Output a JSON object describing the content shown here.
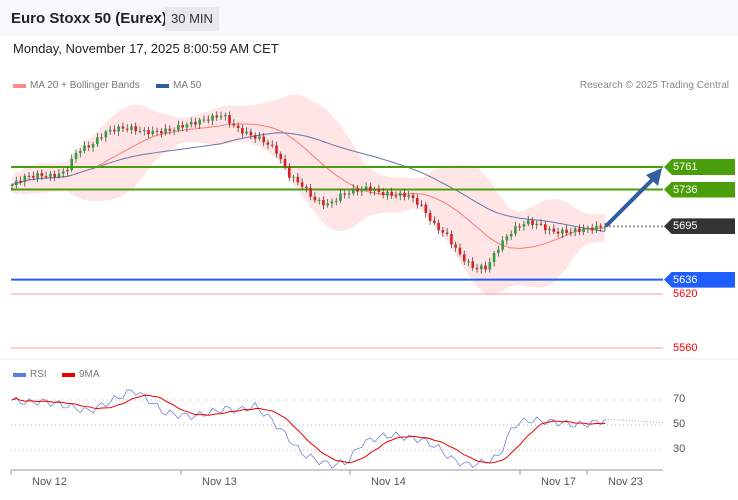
{
  "header": {
    "title": "Euro Stoxx 50 (Eurex)",
    "timeframe": "30 MIN",
    "datetime": "Monday, November 17, 2025 8:00:59 AM CET"
  },
  "legend": {
    "ma20": "MA 20 + Bollinger Bands",
    "ma50": "MA 50",
    "credit": "Research © 2025 Trading Central"
  },
  "rsi_legend": {
    "rsi": "RSI",
    "ma9": "9MA"
  },
  "colors": {
    "up": "#2e9e3a",
    "down": "#d92020",
    "green": "#4a9e0a",
    "blue": "#1e5eff",
    "dark": "#333333",
    "red": "#ff2222"
  },
  "chart_data": {
    "type": "candlestick",
    "price_ylim": [
      5535,
      5835
    ],
    "levels": [
      {
        "label": "5761",
        "value": 5761,
        "kind": "resistance"
      },
      {
        "label": "5736",
        "value": 5736,
        "kind": "resistance"
      },
      {
        "label": "5695",
        "value": 5695,
        "kind": "last"
      },
      {
        "label": "5636",
        "value": 5636,
        "kind": "support"
      },
      {
        "label": "5620",
        "value": 5620,
        "kind": "support2"
      },
      {
        "label": "5560",
        "value": 5560,
        "kind": "support2"
      }
    ],
    "close_path": [
      5741,
      5750,
      5752,
      5751,
      5755,
      5780,
      5785,
      5799,
      5804,
      5804,
      5800,
      5800,
      5802,
      5807,
      5811,
      5815,
      5819,
      5804,
      5797,
      5791,
      5780,
      5752,
      5741,
      5724,
      5719,
      5730,
      5735,
      5738,
      5732,
      5730,
      5730,
      5719,
      5697,
      5685,
      5663,
      5649,
      5649,
      5674,
      5691,
      5700,
      5697,
      5689,
      5689,
      5691,
      5693,
      5695
    ],
    "rsi_path": [
      70,
      68,
      69,
      67,
      64,
      61,
      66,
      72,
      78,
      70,
      60,
      58,
      57,
      60,
      63,
      62,
      65,
      55,
      42,
      28,
      22,
      18,
      20,
      35,
      40,
      42,
      40,
      38,
      32,
      22,
      18,
      20,
      25,
      50,
      54,
      53,
      52,
      50,
      51,
      54
    ],
    "rsi_ticks": [
      "70",
      "50",
      "30"
    ],
    "x_ticks": [
      "Nov 12",
      "Nov 13",
      "Nov 14",
      "Nov 17",
      "Nov 23"
    ]
  }
}
